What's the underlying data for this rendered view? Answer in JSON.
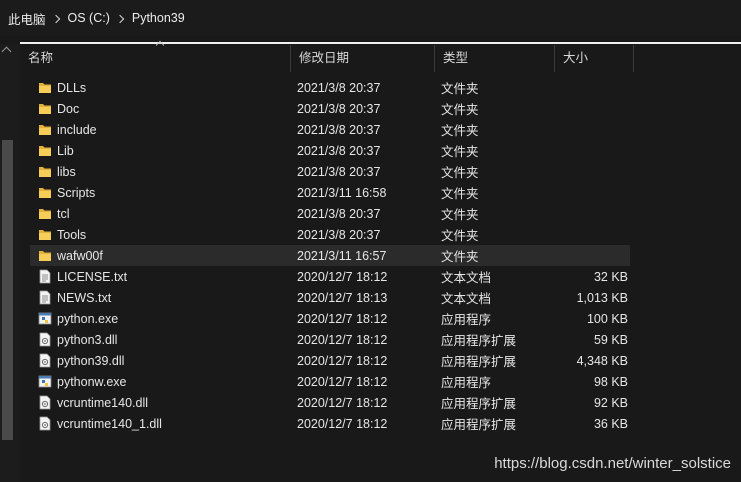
{
  "breadcrumb": [
    "此电脑",
    "OS (C:)",
    "Python39"
  ],
  "columns": {
    "name": "名称",
    "date": "修改日期",
    "type": "类型",
    "size": "大小"
  },
  "files": [
    {
      "name": "DLLs",
      "date": "2021/3/8 20:37",
      "type": "文件夹",
      "size": "",
      "icon": "folder-icon"
    },
    {
      "name": "Doc",
      "date": "2021/3/8 20:37",
      "type": "文件夹",
      "size": "",
      "icon": "folder-icon"
    },
    {
      "name": "include",
      "date": "2021/3/8 20:37",
      "type": "文件夹",
      "size": "",
      "icon": "folder-icon"
    },
    {
      "name": "Lib",
      "date": "2021/3/8 20:37",
      "type": "文件夹",
      "size": "",
      "icon": "folder-icon"
    },
    {
      "name": "libs",
      "date": "2021/3/8 20:37",
      "type": "文件夹",
      "size": "",
      "icon": "folder-icon"
    },
    {
      "name": "Scripts",
      "date": "2021/3/11 16:58",
      "type": "文件夹",
      "size": "",
      "icon": "folder-icon"
    },
    {
      "name": "tcl",
      "date": "2021/3/8 20:37",
      "type": "文件夹",
      "size": "",
      "icon": "folder-icon"
    },
    {
      "name": "Tools",
      "date": "2021/3/8 20:37",
      "type": "文件夹",
      "size": "",
      "icon": "folder-icon"
    },
    {
      "name": "wafw00f",
      "date": "2021/3/11 16:57",
      "type": "文件夹",
      "size": "",
      "icon": "folder-icon",
      "highlight": true
    },
    {
      "name": "LICENSE.txt",
      "date": "2020/12/7 18:12",
      "type": "文本文档",
      "size": "32 KB",
      "icon": "text-file-icon"
    },
    {
      "name": "NEWS.txt",
      "date": "2020/12/7 18:13",
      "type": "文本文档",
      "size": "1,013 KB",
      "icon": "text-file-icon"
    },
    {
      "name": "python.exe",
      "date": "2020/12/7 18:12",
      "type": "应用程序",
      "size": "100 KB",
      "icon": "python-exe-icon"
    },
    {
      "name": "python3.dll",
      "date": "2020/12/7 18:12",
      "type": "应用程序扩展",
      "size": "59 KB",
      "icon": "dll-file-icon"
    },
    {
      "name": "python39.dll",
      "date": "2020/12/7 18:12",
      "type": "应用程序扩展",
      "size": "4,348 KB",
      "icon": "dll-file-icon"
    },
    {
      "name": "pythonw.exe",
      "date": "2020/12/7 18:12",
      "type": "应用程序",
      "size": "98 KB",
      "icon": "python-exe-icon"
    },
    {
      "name": "vcruntime140.dll",
      "date": "2020/12/7 18:12",
      "type": "应用程序扩展",
      "size": "92 KB",
      "icon": "dll-file-icon"
    },
    {
      "name": "vcruntime140_1.dll",
      "date": "2020/12/7 18:12",
      "type": "应用程序扩展",
      "size": "36 KB",
      "icon": "dll-file-icon"
    }
  ],
  "watermark": "https://blog.csdn.net/winter_solstice"
}
